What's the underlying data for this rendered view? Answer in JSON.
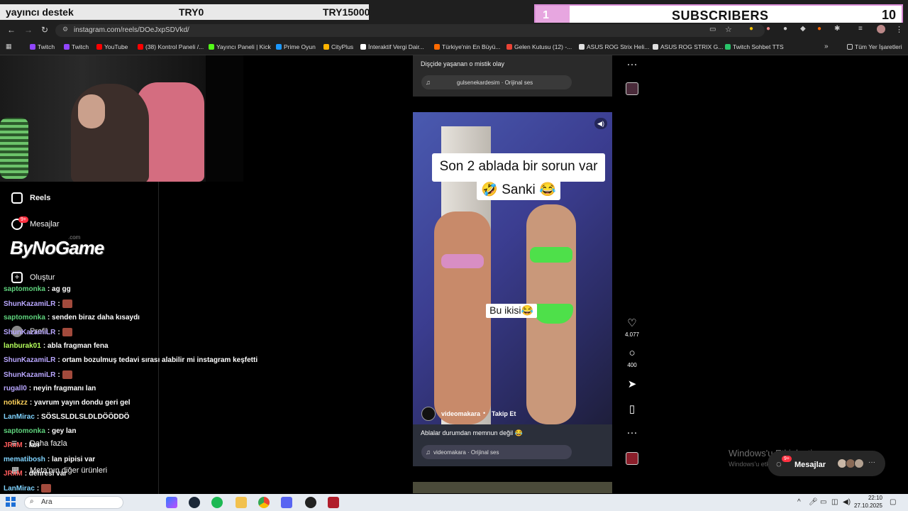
{
  "overlay": {
    "left_title": "yayıncı destek",
    "left_mid": "TRY0",
    "left_goal": "TRY15000",
    "subs_left": "1",
    "subs_label": "SUBSCRIBERS",
    "subs_right": "10"
  },
  "browser": {
    "url": "instagram.com/reels/DOeJxpSDVkd/",
    "bookmarks": [
      {
        "label": "Twitch",
        "color": "#9146ff"
      },
      {
        "label": "Twitch",
        "color": "#9146ff"
      },
      {
        "label": "YouTube",
        "color": "#ff0000"
      },
      {
        "label": "(38) Kontrol Paneli /...",
        "color": "#ff0000"
      },
      {
        "label": "Yayıncı Paneli | Kick",
        "color": "#53fc18"
      },
      {
        "label": "Prime Oyun",
        "color": "#1a98ff"
      },
      {
        "label": "CityPlus",
        "color": "#ffb400"
      },
      {
        "label": "İnteraktif Vergi Dair...",
        "color": "#ffffff"
      },
      {
        "label": "Türkiye'nin En Büyü...",
        "color": "#ff6a00"
      },
      {
        "label": "Gelen Kutusu (12) -...",
        "color": "#ea4335"
      },
      {
        "label": "ASUS ROG Strix Heli...",
        "color": "#e0e0e0"
      },
      {
        "label": "ASUS ROG STRIX G...",
        "color": "#e0e0e0"
      },
      {
        "label": "Twitch Sohbet TTS",
        "color": "#29c46a"
      },
      {
        "label": "Tüm Yer İşaretleri",
        "color": "#cccccc"
      }
    ]
  },
  "sidebar": {
    "reels": "Reels",
    "messages": "Mesajlar",
    "messages_badge": "9+",
    "create": "Oluştur",
    "profile": "Profil",
    "more": "Daha fazla",
    "meta": "Meta'nın diğer ürünleri",
    "logo": "ByNoGame",
    "logo_suffix": ".com"
  },
  "chat": [
    {
      "user": "saptomonka",
      "msg": ": ag gg",
      "color": "#5fd37d",
      "emote": false
    },
    {
      "user": "ShunKazamiLR",
      "msg": ":",
      "color": "#b9a7ff",
      "emote": true
    },
    {
      "user": "saptomonka",
      "msg": ": senden biraz daha kısaydı",
      "color": "#5fd37d",
      "emote": false
    },
    {
      "user": "ShunKazamiLR",
      "msg": ":",
      "color": "#b9a7ff",
      "emote": true
    },
    {
      "user": "lanburak01",
      "msg": ": abla fragman fena",
      "color": "#b6ff5c",
      "emote": false
    },
    {
      "user": "ShunKazamiLR",
      "msg": ": ortam bozulmuş tedavi sırası alabilir mi instagram keşfetti",
      "color": "#b9a7ff",
      "emote": false
    },
    {
      "user": "ShunKazamiLR",
      "msg": ":",
      "color": "#b9a7ff",
      "emote": true
    },
    {
      "user": "rugall0",
      "msg": ": neyin fragmanı lan",
      "color": "#b9a7ff",
      "emote": false
    },
    {
      "user": "notikzz",
      "msg": ": yavrum yayın dondu geri gel",
      "color": "#ffd35c",
      "emote": false
    },
    {
      "user": "LanMirac",
      "msg": ": SÖSLSLDLSLDLDÖÖDDÖ",
      "color": "#7fd3ff",
      "emote": false
    },
    {
      "user": "saptomonka",
      "msg": ": gey lan",
      "color": "#5fd37d",
      "emote": false
    },
    {
      "user": "JRxM",
      "msg": ": lan",
      "color": "#ff5c5c",
      "emote": false
    },
    {
      "user": "mematibosh",
      "msg": ": lan pipisi var",
      "color": "#7fd3ff",
      "emote": false
    },
    {
      "user": "JRxM",
      "msg": ": dehresi var",
      "color": "#ff5c5c",
      "emote": false
    },
    {
      "user": "LanMirac",
      "msg": ":",
      "color": "#7fd3ff",
      "emote": true
    }
  ],
  "reel_top": {
    "title": "Dişçide yaşanan o mistik olay",
    "audio": "gulsenekardesim · Orijinal ses"
  },
  "reel": {
    "caption_line1": "Son 2 ablada bir sorun var",
    "caption_line2": "🤣 Sanki 😂",
    "caption_small": "Bu ikisi😂",
    "author": "videomakara",
    "dot": "•",
    "follow": "Takip Et",
    "description": "Ablalar durumdan memnun değil 😂",
    "audio": "videomakara · Orijinal ses",
    "likes": "4.077",
    "comments": "400"
  },
  "messages_pill": {
    "label": "Mesajlar",
    "badge": "9+"
  },
  "windows": {
    "activate_title": "Windows'u Etkinleştir",
    "activate_sub": "Windows'u etkinleştirmek için Ayarlar'a gidin."
  },
  "taskbar": {
    "search": "Ara",
    "time": "22:10",
    "date": "27.10.2025"
  }
}
